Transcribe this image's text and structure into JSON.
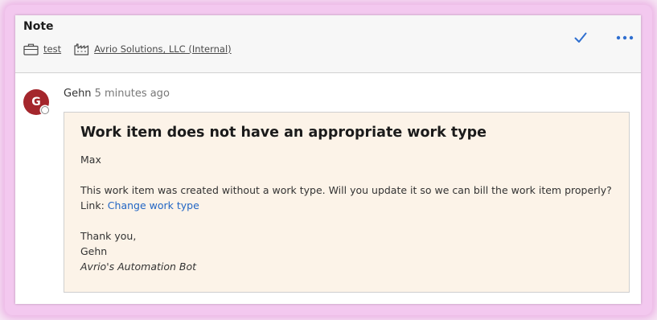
{
  "header": {
    "title": "Note",
    "ticket_label": "test",
    "company_label": "Avrio Solutions, LLC (Internal)"
  },
  "icons": {
    "ticket": "briefcase-icon",
    "company": "factory-icon",
    "check": "checkmark-icon",
    "more": "more-options-icon"
  },
  "colors": {
    "accent": "#2f6fd0",
    "avatar_bg": "#a4262c",
    "message_bg": "#fcf3e8",
    "link": "#2266c4"
  },
  "comment": {
    "avatar_initial": "G",
    "author": "Gehn",
    "time": "5 minutes ago",
    "message": {
      "title": "Work item does not have an appropriate work type",
      "greeting": "Max",
      "body": "This work item was created without a work type. Will you update it so we can bill the work item properly?",
      "link_prefix": "Link: ",
      "link_text": "Change work type",
      "closing": "Thank you,",
      "signature_name": "Gehn",
      "signature_org": "Avrio's Automation Bot"
    }
  }
}
